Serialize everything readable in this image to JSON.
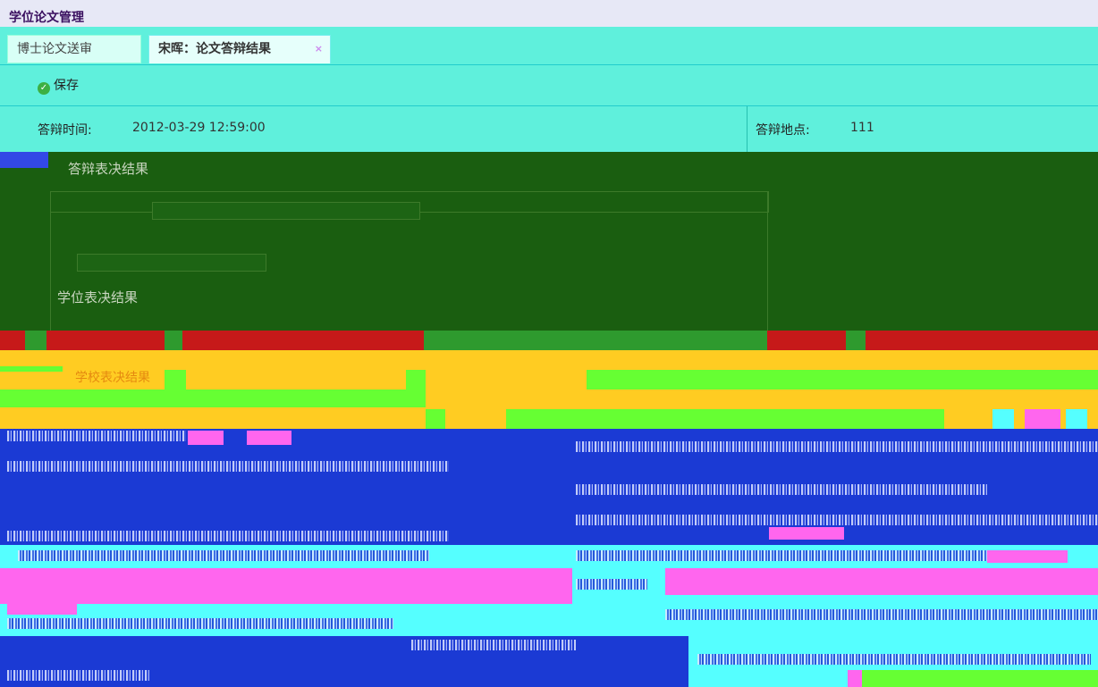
{
  "app": {
    "title": "学位论文管理"
  },
  "tabs": [
    {
      "label": "博士论文送审",
      "active": false
    },
    {
      "label": "宋晖：论文答辩结果",
      "active": true,
      "close": "×"
    }
  ],
  "toolbar": {
    "save_label": "保存",
    "save_icon": "check-circle-icon"
  },
  "defense": {
    "time_label": "答辩时间:",
    "time_value": "2012-03-29 12:59:00",
    "place_label": "答辩地点:",
    "place_value": "111"
  },
  "sections": {
    "defense_result": "答辩表决结果",
    "degree_result": "学位表决结果",
    "school_result": "学校表决结果"
  },
  "colors": {
    "title_bg": "#e7e8f6",
    "panel_bg": "#5ff0dc",
    "form_bg": "#1a5e10",
    "band_red": "#c61919",
    "band_yellow": "#ffcc22",
    "area_blue": "#1b3ad4"
  }
}
